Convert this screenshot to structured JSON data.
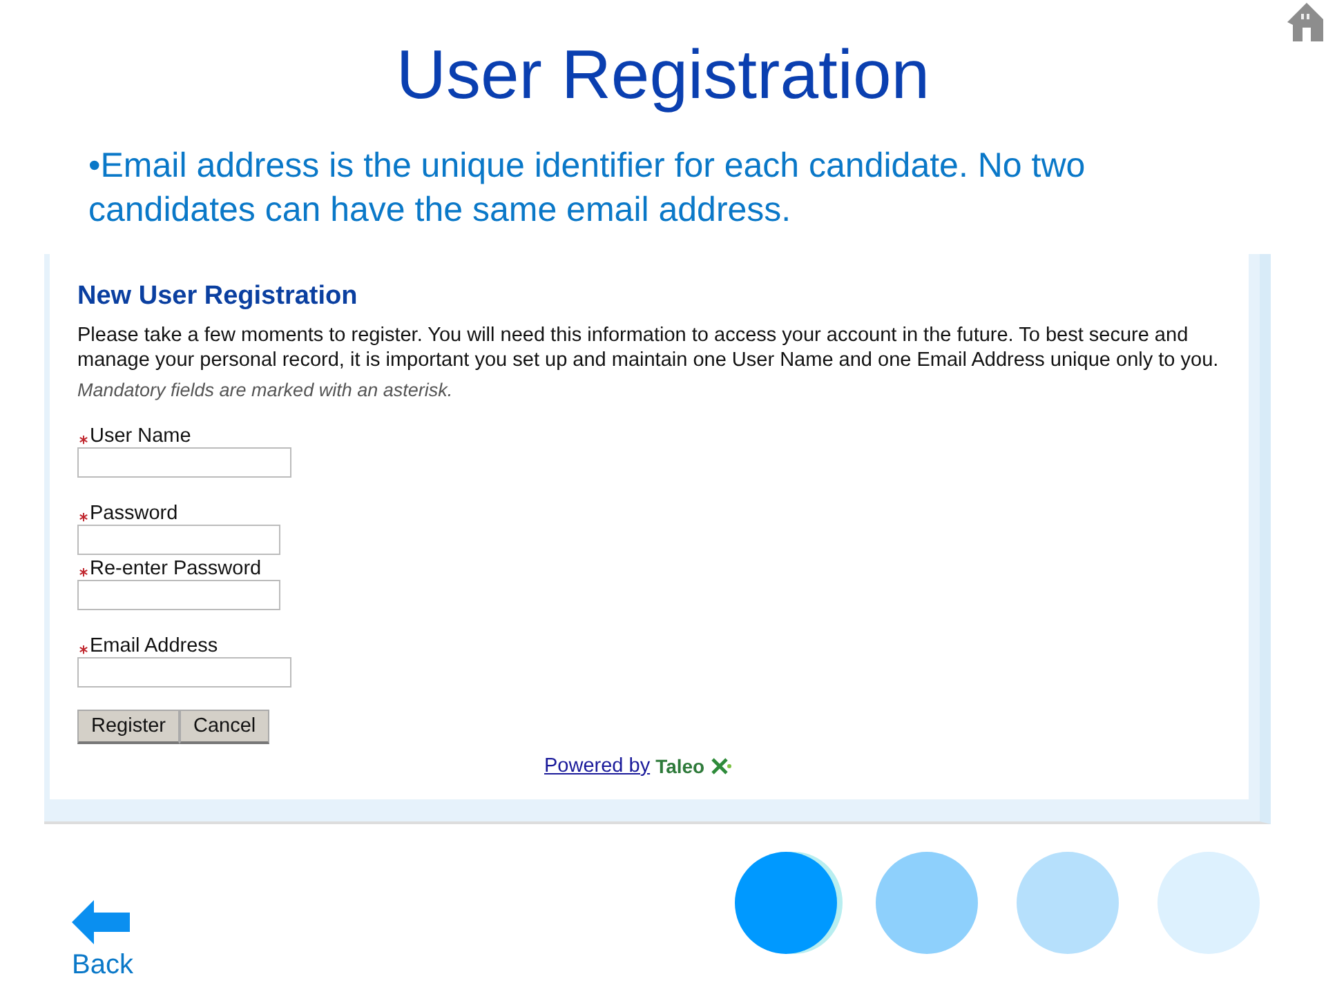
{
  "slide": {
    "title": "User Registration",
    "bullet": "•Email address is the unique identifier for each candidate. No two candidates can have the same email address."
  },
  "form": {
    "heading": "New User Registration",
    "intro": "Please take a few moments to register. You will need this information to access your account in the future. To best secure and manage your personal record, it is important you set up and maintain one User Name and one Email Address unique only to you.",
    "note": "Mandatory fields are marked with an asterisk.",
    "field_groups": [
      [
        {
          "label": "User Name",
          "required": true,
          "kind": "text"
        }
      ],
      [
        {
          "label": "Password",
          "required": true,
          "kind": "password"
        },
        {
          "label": "Re-enter Password",
          "required": true,
          "kind": "password"
        }
      ],
      [
        {
          "label": "Email Address",
          "required": true,
          "kind": "text"
        }
      ]
    ],
    "buttons": [
      "Register",
      "Cancel"
    ],
    "footer": {
      "link": "Powered by",
      "brand": "Taleo"
    }
  },
  "navigation": {
    "back": "Back",
    "dots": [
      {
        "selected": true,
        "color": "#0099ff"
      },
      {
        "selected": false,
        "color": "#8ed0fc"
      },
      {
        "selected": false,
        "color": "#b6e0fc"
      },
      {
        "selected": false,
        "color": "#ddf1fe"
      }
    ]
  }
}
